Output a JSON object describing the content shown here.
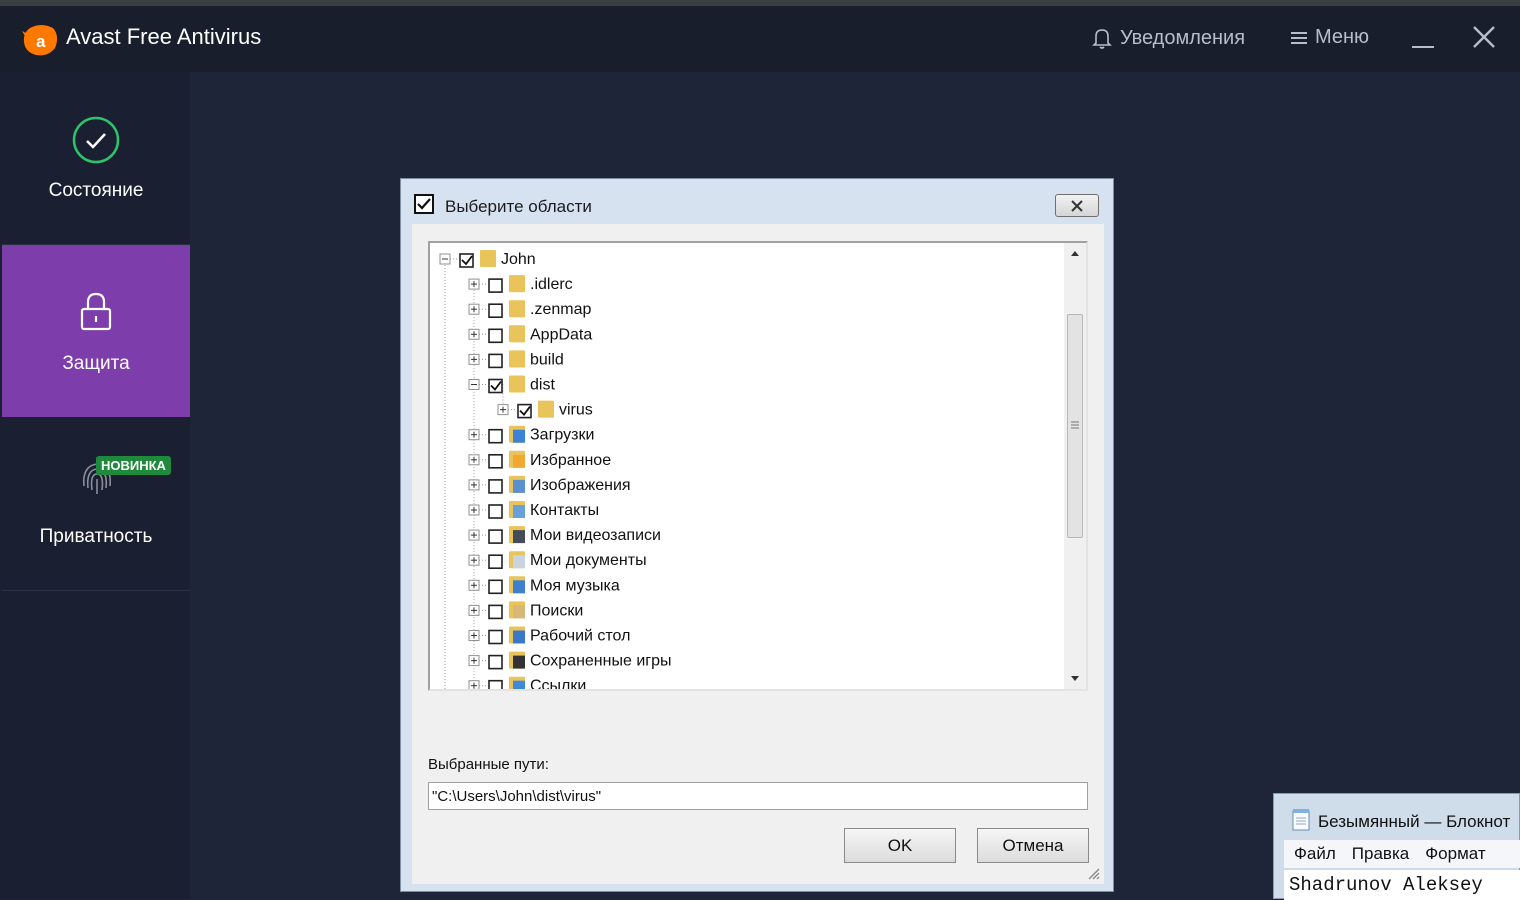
{
  "app": {
    "title": "Avast Free Antivirus",
    "notifications_label": "Уведомления",
    "menu_label": "Меню",
    "accent": "#7d3dab",
    "logo_color": "#ff7800"
  },
  "sidebar": {
    "items": [
      {
        "label": "Состояние",
        "icon": "check-circle-icon"
      },
      {
        "label": "Защита",
        "icon": "lock-icon",
        "active": true
      },
      {
        "label": "Приватность",
        "icon": "fingerprint-icon",
        "badge": "НОВИНКА"
      }
    ]
  },
  "dialog": {
    "title": "Выберите области",
    "tree": [
      {
        "label": "John",
        "level": 0,
        "checked": true,
        "expanded": true,
        "icon": "user-folder-icon"
      },
      {
        "label": ".idlerc",
        "level": 1,
        "checked": false,
        "icon": "folder-icon"
      },
      {
        "label": ".zenmap",
        "level": 1,
        "checked": false,
        "icon": "folder-icon"
      },
      {
        "label": "AppData",
        "level": 1,
        "checked": false,
        "icon": "folder-icon"
      },
      {
        "label": "build",
        "level": 1,
        "checked": false,
        "icon": "folder-icon"
      },
      {
        "label": "dist",
        "level": 1,
        "checked": true,
        "expanded": true,
        "icon": "folder-icon"
      },
      {
        "label": "virus",
        "level": 2,
        "checked": true,
        "icon": "folder-icon"
      },
      {
        "label": "Загрузки",
        "level": 1,
        "checked": false,
        "icon": "downloads-icon"
      },
      {
        "label": "Избранное",
        "level": 1,
        "checked": false,
        "icon": "favorites-icon"
      },
      {
        "label": "Изображения",
        "level": 1,
        "checked": false,
        "icon": "pictures-icon"
      },
      {
        "label": "Контакты",
        "level": 1,
        "checked": false,
        "icon": "contacts-icon"
      },
      {
        "label": "Мои видеозаписи",
        "level": 1,
        "checked": false,
        "icon": "videos-icon"
      },
      {
        "label": "Мои документы",
        "level": 1,
        "checked": false,
        "icon": "documents-icon"
      },
      {
        "label": "Моя музыка",
        "level": 1,
        "checked": false,
        "icon": "music-icon"
      },
      {
        "label": "Поиски",
        "level": 1,
        "checked": false,
        "icon": "searches-icon"
      },
      {
        "label": "Рабочий стол",
        "level": 1,
        "checked": false,
        "icon": "desktop-icon"
      },
      {
        "label": "Сохраненные игры",
        "level": 1,
        "checked": false,
        "icon": "saved-games-icon"
      },
      {
        "label": "Ссылки",
        "level": 1,
        "checked": false,
        "icon": "links-icon"
      }
    ],
    "selected_paths_label": "Выбранные пути:",
    "selected_paths_value": "\"C:\\Users\\John\\dist\\virus\"",
    "ok_label": "OK",
    "cancel_label": "Отмена"
  },
  "notepad": {
    "title": "Безымянный — Блокнот",
    "menu": [
      "Файл",
      "Правка",
      "Формат"
    ],
    "content": "Shadrunov Aleksey"
  }
}
